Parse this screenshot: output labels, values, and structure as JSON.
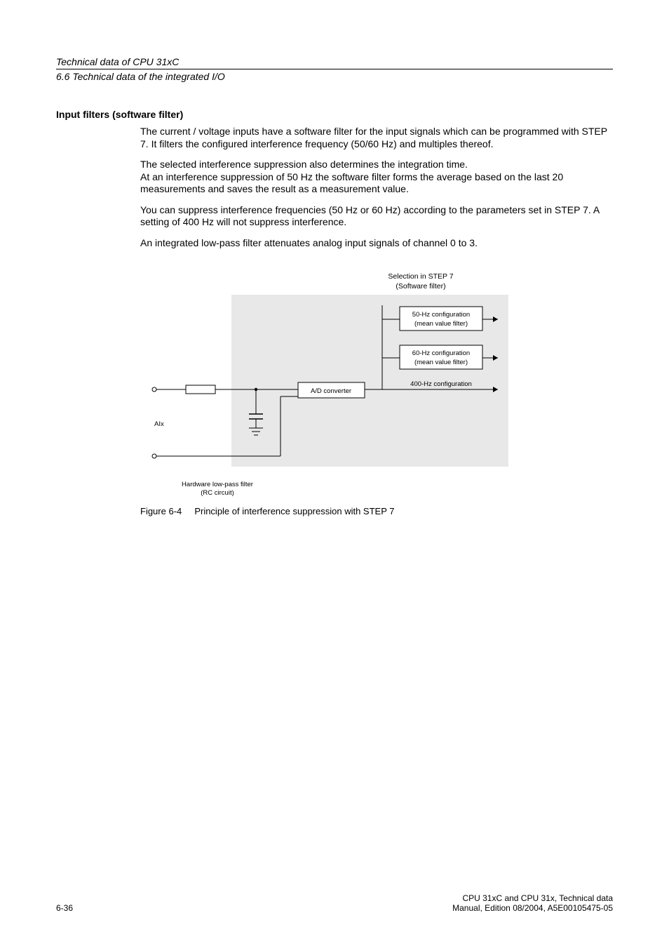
{
  "header": {
    "chapter": "Technical data of CPU 31xC",
    "section": "6.6 Technical data of the integrated I/O"
  },
  "section": {
    "heading": "Input filters (software filter)",
    "paragraphs": {
      "p1": "The current / voltage inputs have a software filter for the input signals which can be programmed with STEP 7. It filters the configured interference frequency (50/60 Hz) and multiples thereof.",
      "p2": "The selected interference suppression also determines the integration time.\n At an interference suppression of 50 Hz the software filter forms the average based on the last 20 measurements and saves the result as a measurement value.",
      "p3": "You can suppress interference frequencies (50 Hz or 60 Hz) according to the parameters set in STEP 7. A setting of 400 Hz will not suppress interference.",
      "p4": "An integrated low-pass filter attenuates analog input signals of channel 0 to 3."
    }
  },
  "figure": {
    "selection_title_l1": "Selection in STEP 7",
    "selection_title_l2": "(Software filter)",
    "box50_l1": "50-Hz configuration",
    "box50_l2": "(mean value filter)",
    "box60_l1": "60-Hz configuration",
    "box60_l2": "(mean value filter)",
    "box400_l1": "400-Hz configuration",
    "adc_label": "A/D converter",
    "ai_label": "AIx",
    "hw_filter_l1": "Hardware low-pass filter",
    "hw_filter_l2": "(RC circuit)",
    "caption_no": "Figure 6-4",
    "caption_text": "Principle of interference suppression with STEP 7"
  },
  "footer": {
    "page_no": "6-36",
    "doc_title": "CPU 31xC and CPU 31x, Technical data",
    "doc_info": "Manual, Edition 08/2004, A5E00105475-05"
  }
}
